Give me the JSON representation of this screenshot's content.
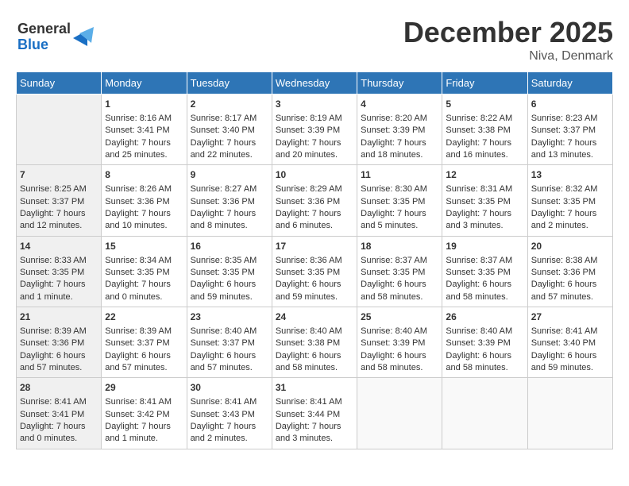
{
  "header": {
    "logo_line1": "General",
    "logo_line2": "Blue",
    "month": "December 2025",
    "location": "Niva, Denmark"
  },
  "weekdays": [
    "Sunday",
    "Monday",
    "Tuesday",
    "Wednesday",
    "Thursday",
    "Friday",
    "Saturday"
  ],
  "weeks": [
    [
      {
        "day": "",
        "sunrise": "",
        "sunset": "",
        "daylight": ""
      },
      {
        "day": "1",
        "sunrise": "Sunrise: 8:16 AM",
        "sunset": "Sunset: 3:41 PM",
        "daylight": "Daylight: 7 hours and 25 minutes."
      },
      {
        "day": "2",
        "sunrise": "Sunrise: 8:17 AM",
        "sunset": "Sunset: 3:40 PM",
        "daylight": "Daylight: 7 hours and 22 minutes."
      },
      {
        "day": "3",
        "sunrise": "Sunrise: 8:19 AM",
        "sunset": "Sunset: 3:39 PM",
        "daylight": "Daylight: 7 hours and 20 minutes."
      },
      {
        "day": "4",
        "sunrise": "Sunrise: 8:20 AM",
        "sunset": "Sunset: 3:39 PM",
        "daylight": "Daylight: 7 hours and 18 minutes."
      },
      {
        "day": "5",
        "sunrise": "Sunrise: 8:22 AM",
        "sunset": "Sunset: 3:38 PM",
        "daylight": "Daylight: 7 hours and 16 minutes."
      },
      {
        "day": "6",
        "sunrise": "Sunrise: 8:23 AM",
        "sunset": "Sunset: 3:37 PM",
        "daylight": "Daylight: 7 hours and 13 minutes."
      }
    ],
    [
      {
        "day": "7",
        "sunrise": "Sunrise: 8:25 AM",
        "sunset": "Sunset: 3:37 PM",
        "daylight": "Daylight: 7 hours and 12 minutes."
      },
      {
        "day": "8",
        "sunrise": "Sunrise: 8:26 AM",
        "sunset": "Sunset: 3:36 PM",
        "daylight": "Daylight: 7 hours and 10 minutes."
      },
      {
        "day": "9",
        "sunrise": "Sunrise: 8:27 AM",
        "sunset": "Sunset: 3:36 PM",
        "daylight": "Daylight: 7 hours and 8 minutes."
      },
      {
        "day": "10",
        "sunrise": "Sunrise: 8:29 AM",
        "sunset": "Sunset: 3:36 PM",
        "daylight": "Daylight: 7 hours and 6 minutes."
      },
      {
        "day": "11",
        "sunrise": "Sunrise: 8:30 AM",
        "sunset": "Sunset: 3:35 PM",
        "daylight": "Daylight: 7 hours and 5 minutes."
      },
      {
        "day": "12",
        "sunrise": "Sunrise: 8:31 AM",
        "sunset": "Sunset: 3:35 PM",
        "daylight": "Daylight: 7 hours and 3 minutes."
      },
      {
        "day": "13",
        "sunrise": "Sunrise: 8:32 AM",
        "sunset": "Sunset: 3:35 PM",
        "daylight": "Daylight: 7 hours and 2 minutes."
      }
    ],
    [
      {
        "day": "14",
        "sunrise": "Sunrise: 8:33 AM",
        "sunset": "Sunset: 3:35 PM",
        "daylight": "Daylight: 7 hours and 1 minute."
      },
      {
        "day": "15",
        "sunrise": "Sunrise: 8:34 AM",
        "sunset": "Sunset: 3:35 PM",
        "daylight": "Daylight: 7 hours and 0 minutes."
      },
      {
        "day": "16",
        "sunrise": "Sunrise: 8:35 AM",
        "sunset": "Sunset: 3:35 PM",
        "daylight": "Daylight: 6 hours and 59 minutes."
      },
      {
        "day": "17",
        "sunrise": "Sunrise: 8:36 AM",
        "sunset": "Sunset: 3:35 PM",
        "daylight": "Daylight: 6 hours and 59 minutes."
      },
      {
        "day": "18",
        "sunrise": "Sunrise: 8:37 AM",
        "sunset": "Sunset: 3:35 PM",
        "daylight": "Daylight: 6 hours and 58 minutes."
      },
      {
        "day": "19",
        "sunrise": "Sunrise: 8:37 AM",
        "sunset": "Sunset: 3:35 PM",
        "daylight": "Daylight: 6 hours and 58 minutes."
      },
      {
        "day": "20",
        "sunrise": "Sunrise: 8:38 AM",
        "sunset": "Sunset: 3:36 PM",
        "daylight": "Daylight: 6 hours and 57 minutes."
      }
    ],
    [
      {
        "day": "21",
        "sunrise": "Sunrise: 8:39 AM",
        "sunset": "Sunset: 3:36 PM",
        "daylight": "Daylight: 6 hours and 57 minutes."
      },
      {
        "day": "22",
        "sunrise": "Sunrise: 8:39 AM",
        "sunset": "Sunset: 3:37 PM",
        "daylight": "Daylight: 6 hours and 57 minutes."
      },
      {
        "day": "23",
        "sunrise": "Sunrise: 8:40 AM",
        "sunset": "Sunset: 3:37 PM",
        "daylight": "Daylight: 6 hours and 57 minutes."
      },
      {
        "day": "24",
        "sunrise": "Sunrise: 8:40 AM",
        "sunset": "Sunset: 3:38 PM",
        "daylight": "Daylight: 6 hours and 58 minutes."
      },
      {
        "day": "25",
        "sunrise": "Sunrise: 8:40 AM",
        "sunset": "Sunset: 3:39 PM",
        "daylight": "Daylight: 6 hours and 58 minutes."
      },
      {
        "day": "26",
        "sunrise": "Sunrise: 8:40 AM",
        "sunset": "Sunset: 3:39 PM",
        "daylight": "Daylight: 6 hours and 58 minutes."
      },
      {
        "day": "27",
        "sunrise": "Sunrise: 8:41 AM",
        "sunset": "Sunset: 3:40 PM",
        "daylight": "Daylight: 6 hours and 59 minutes."
      }
    ],
    [
      {
        "day": "28",
        "sunrise": "Sunrise: 8:41 AM",
        "sunset": "Sunset: 3:41 PM",
        "daylight": "Daylight: 7 hours and 0 minutes."
      },
      {
        "day": "29",
        "sunrise": "Sunrise: 8:41 AM",
        "sunset": "Sunset: 3:42 PM",
        "daylight": "Daylight: 7 hours and 1 minute."
      },
      {
        "day": "30",
        "sunrise": "Sunrise: 8:41 AM",
        "sunset": "Sunset: 3:43 PM",
        "daylight": "Daylight: 7 hours and 2 minutes."
      },
      {
        "day": "31",
        "sunrise": "Sunrise: 8:41 AM",
        "sunset": "Sunset: 3:44 PM",
        "daylight": "Daylight: 7 hours and 3 minutes."
      },
      {
        "day": "",
        "sunrise": "",
        "sunset": "",
        "daylight": ""
      },
      {
        "day": "",
        "sunrise": "",
        "sunset": "",
        "daylight": ""
      },
      {
        "day": "",
        "sunrise": "",
        "sunset": "",
        "daylight": ""
      }
    ]
  ]
}
